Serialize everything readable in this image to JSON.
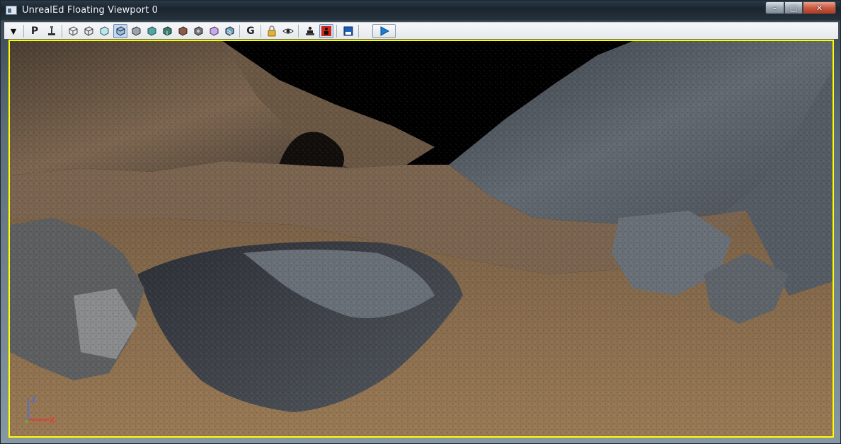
{
  "window": {
    "title": "UnrealEd Floating Viewport 0",
    "controls": {
      "minimize": "–",
      "maximize": "□",
      "close": "✕"
    }
  },
  "toolbar": {
    "menu_glyph": "▼",
    "perspective_label": "P",
    "game_view_label": "G",
    "icons": [
      "dropdown-arrow-icon",
      "perspective-icon",
      "pivot-icon",
      "wireframe-icon",
      "unlit-icon",
      "lit-icon",
      "brush-wireframe-icon",
      "lighting-only-icon",
      "light-complexity-icon",
      "texture-density-icon",
      "shader-complexity-icon",
      "lightmap-density-icon",
      "lit-lightmap-icon",
      "reflections-icon",
      "game-view-icon",
      "lock-icon",
      "eye-icon",
      "actor-icon",
      "matinee-icon",
      "save-icon",
      "play-icon"
    ],
    "accent": "#1c5fb8"
  },
  "viewport": {
    "border_color": "#ffff00",
    "axis": {
      "x": "X",
      "y": "Y",
      "z": "Z",
      "x_color": "#ff2a2a",
      "y_color": "#33dd33",
      "z_color": "#3a6cff"
    }
  }
}
